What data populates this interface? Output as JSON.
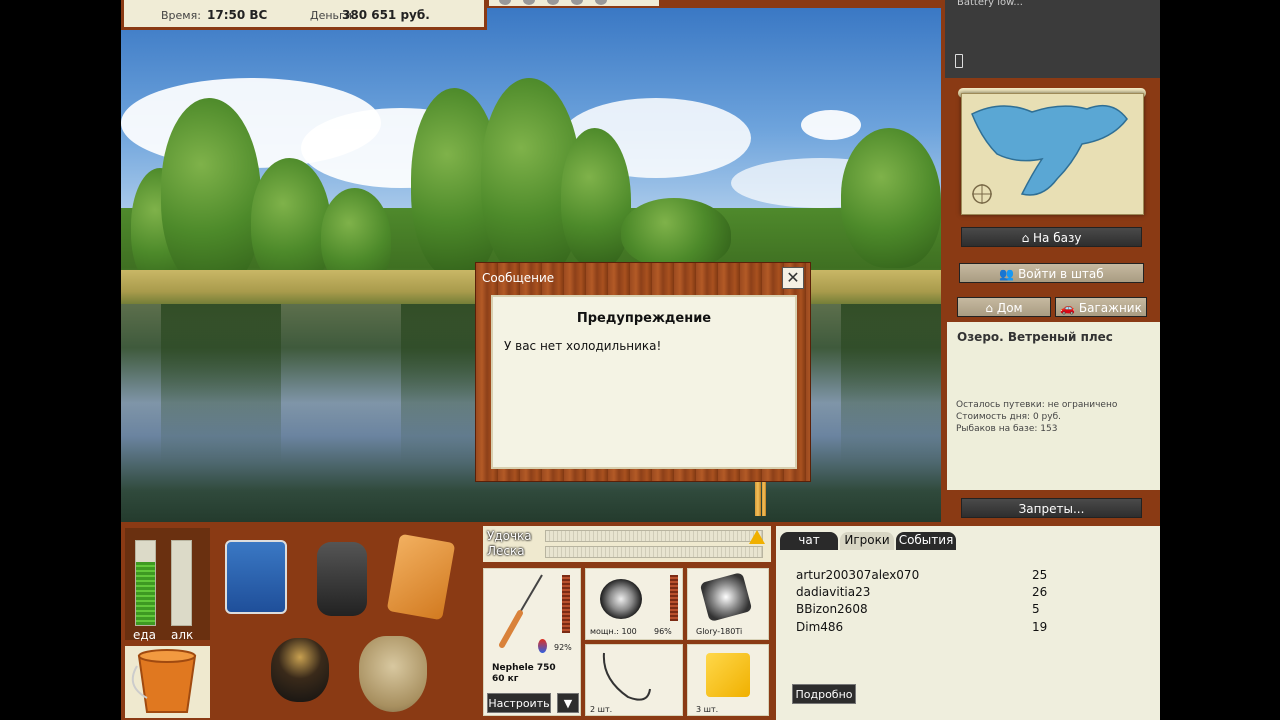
{
  "status": {
    "time_label": "Время:",
    "time_value": "17:50 ВС",
    "money_label": "Деньги:",
    "money_value": "380 651 руб."
  },
  "phone": {
    "text": "Battery low..."
  },
  "dialog": {
    "title": "Сообщение",
    "close": "✕",
    "heading": "Предупреждение",
    "text": "У вас нет холодильника!"
  },
  "right_panel": {
    "btn_base": "На базу",
    "btn_hq": "Войти в штаб",
    "btn_home": "Дом",
    "btn_trunk": "Багажник",
    "location_title": "Озеро. Ветреный плес",
    "trips_left": "Осталось путевки: не ограничено",
    "day_cost": "Стоимость дня: 0 руб.",
    "fishers": "Рыбаков на базе: 153",
    "btn_bans": "Запреты..."
  },
  "meters": {
    "food_label": "еда",
    "alc_label": "алк",
    "food_level": 0.75,
    "alc_level": 0
  },
  "slots": [
    "1",
    "2",
    "3"
  ],
  "tackle": {
    "rod_label": "Удочка",
    "line_label": "Леска",
    "rod_name": "Nephele 750",
    "rod_weight": "60 кг",
    "rod_pct": "92%",
    "reel_power": "мощн.: 100",
    "reel_pct": "96%",
    "line_name": "Glory-180Ti",
    "hooks_qty": "2 шт.",
    "bait_qty": "3 шт.",
    "btn_setup": "Настроить",
    "btn_arrow": "▼"
  },
  "chat": {
    "tabs": [
      "чат",
      "Игроки",
      "События"
    ],
    "players": [
      {
        "name": "artur200307alex070",
        "value": "25"
      },
      {
        "name": "dadiavitia23",
        "value": "26"
      },
      {
        "name": "BBizon2608",
        "value": "5"
      },
      {
        "name": "Dim486",
        "value": "19"
      }
    ],
    "btn_more": "Подробно"
  }
}
